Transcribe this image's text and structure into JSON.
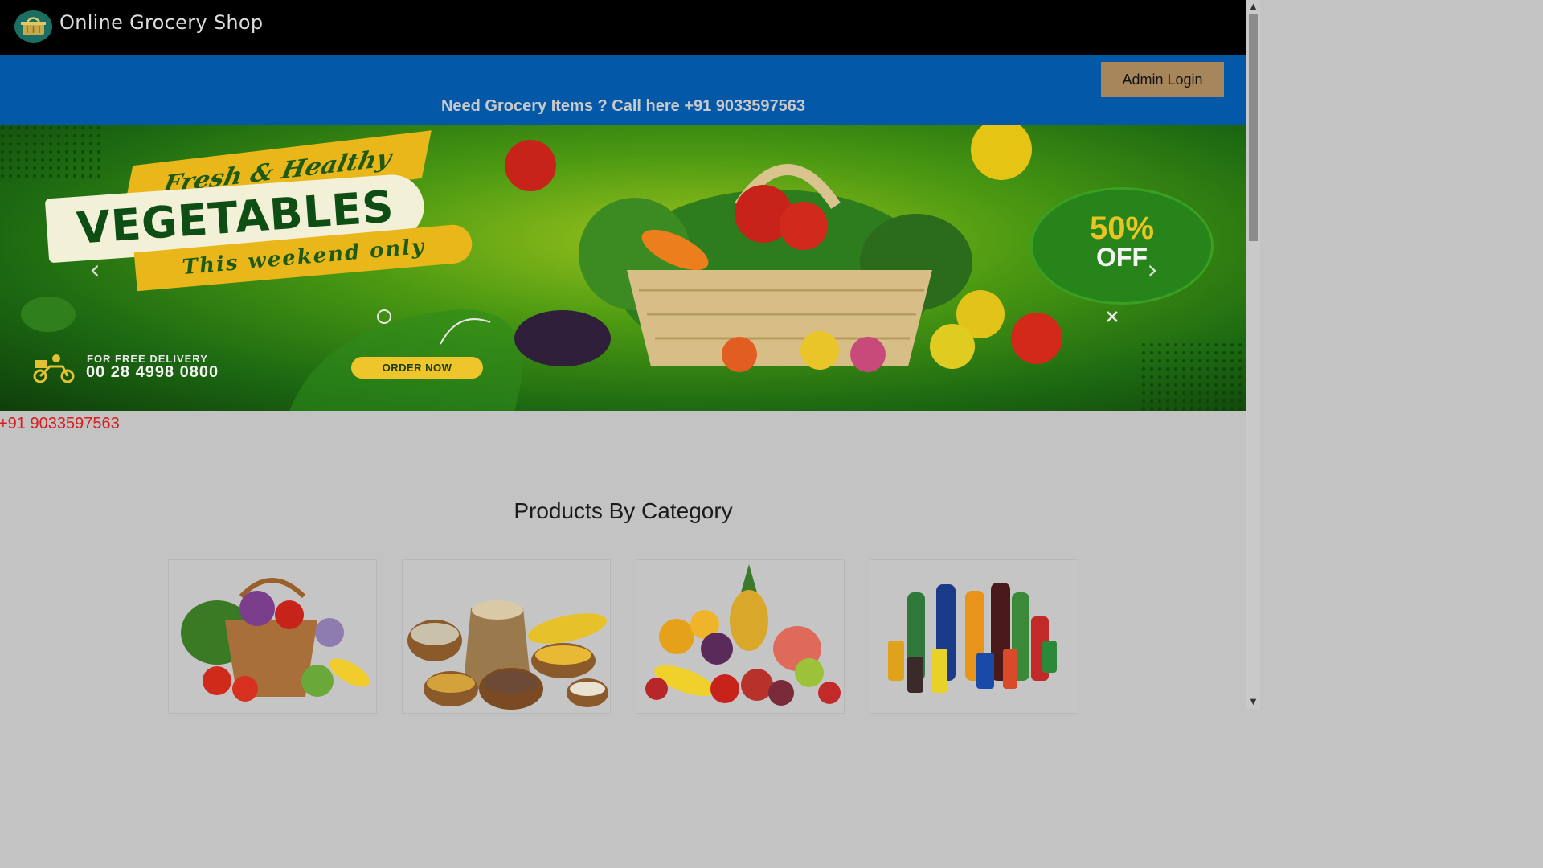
{
  "header": {
    "brand_title": "Online Grocery Shop",
    "brand_icon": "basket-icon"
  },
  "topbar": {
    "admin_login_label": "Admin Login",
    "helpline_text": "Need Grocery Items ? Call here +91 9033597563"
  },
  "banner": {
    "tagline_top": "Fresh & Healthy",
    "headline": "VEGETABLES",
    "tagline_bottom": "This weekend only",
    "delivery_label": "FOR FREE DELIVERY",
    "delivery_phone": "00 28 4998 0800",
    "order_button": "ORDER NOW",
    "offer_percent": "50%",
    "offer_off": "OFF",
    "prev_icon": "chevron-left-icon",
    "next_icon": "chevron-right-icon"
  },
  "contact": {
    "phone": "+91 9033597563"
  },
  "products": {
    "section_title": "Products By Category",
    "categories": [
      {
        "icon": "vegetables-basket-image"
      },
      {
        "icon": "grains-image"
      },
      {
        "icon": "fruits-image"
      },
      {
        "icon": "beverages-image"
      }
    ]
  },
  "colors": {
    "navbar": "#000000",
    "topbar": "#0359a8",
    "admin_button": "#a8865b",
    "phone_link": "#d81b1b",
    "page_overlay": "#c3c3c3"
  }
}
